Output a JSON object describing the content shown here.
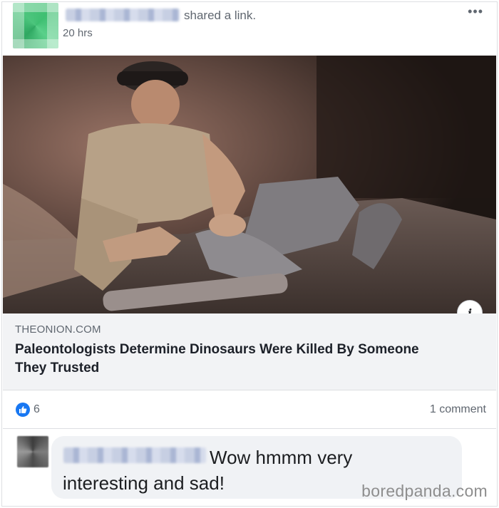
{
  "post": {
    "shared_text": "shared a link.",
    "time": "20 hrs",
    "more_label": "•••"
  },
  "link": {
    "domain": "THEONION.COM",
    "title": "Paleontologists Determine Dinosaurs Were Killed By Someone They Trusted",
    "info_label": "i"
  },
  "reactions": {
    "like_count": "6",
    "comment_count": "1 comment"
  },
  "comment": {
    "text": "Wow hmmm very interesting and sad!"
  },
  "watermark": "boredpanda.com",
  "colors": {
    "like_blue": "#1877f2",
    "caption_bg": "#f2f3f5",
    "bubble_bg": "#f0f2f5"
  },
  "icons": {
    "like": "thumbs-up-icon",
    "info": "info-icon",
    "more": "more-dots-icon"
  }
}
